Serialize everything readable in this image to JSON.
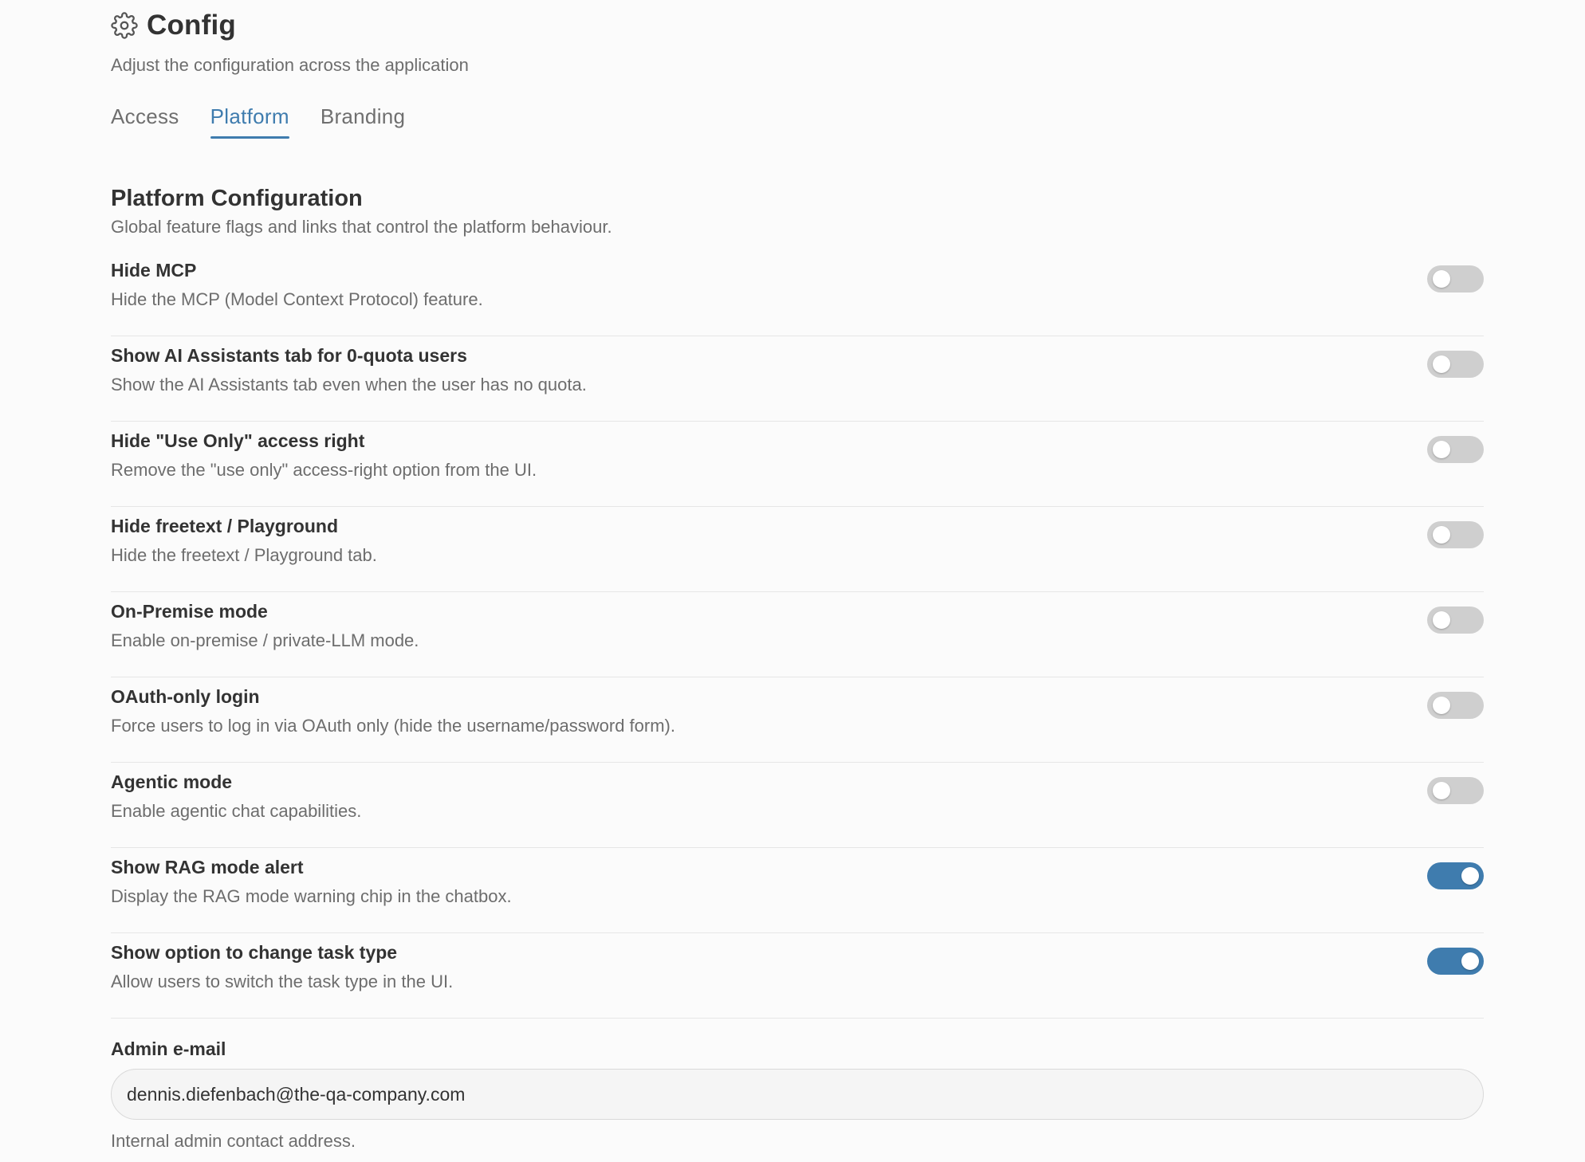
{
  "header": {
    "title": "Config",
    "subtitle": "Adjust the configuration across the application",
    "icon": "gear-icon"
  },
  "tabs": [
    {
      "label": "Access",
      "active": false
    },
    {
      "label": "Platform",
      "active": true
    },
    {
      "label": "Branding",
      "active": false
    }
  ],
  "section": {
    "title": "Platform Configuration",
    "description": "Global feature flags and links that control the platform behaviour."
  },
  "settings": [
    {
      "label": "Hide MCP",
      "description": "Hide the MCP (Model Context Protocol) feature.",
      "enabled": false
    },
    {
      "label": "Show AI Assistants tab for 0-quota users",
      "description": "Show the AI Assistants tab even when the user has no quota.",
      "enabled": false
    },
    {
      "label": "Hide \"Use Only\" access right",
      "description": "Remove the \"use only\" access-right option from the UI.",
      "enabled": false
    },
    {
      "label": "Hide freetext / Playground",
      "description": "Hide the freetext / Playground tab.",
      "enabled": false
    },
    {
      "label": "On-Premise mode",
      "description": "Enable on-premise / private-LLM mode.",
      "enabled": false
    },
    {
      "label": "OAuth-only login",
      "description": "Force users to log in via OAuth only (hide the username/password form).",
      "enabled": false
    },
    {
      "label": "Agentic mode",
      "description": "Enable agentic chat capabilities.",
      "enabled": false
    },
    {
      "label": "Show RAG mode alert",
      "description": "Display the RAG mode warning chip in the chatbox.",
      "enabled": true
    },
    {
      "label": "Show option to change task type",
      "description": "Allow users to switch the task type in the UI.",
      "enabled": true
    }
  ],
  "admin_email": {
    "label": "Admin e-mail",
    "value": "dennis.diefenbach@the-qa-company.com",
    "help": "Internal admin contact address."
  },
  "colors": {
    "accent": "#3f7cae",
    "toggle_off": "#cfcfcf",
    "text": "#333333",
    "muted": "#6d6d6d",
    "background": "#fbfbfb"
  }
}
